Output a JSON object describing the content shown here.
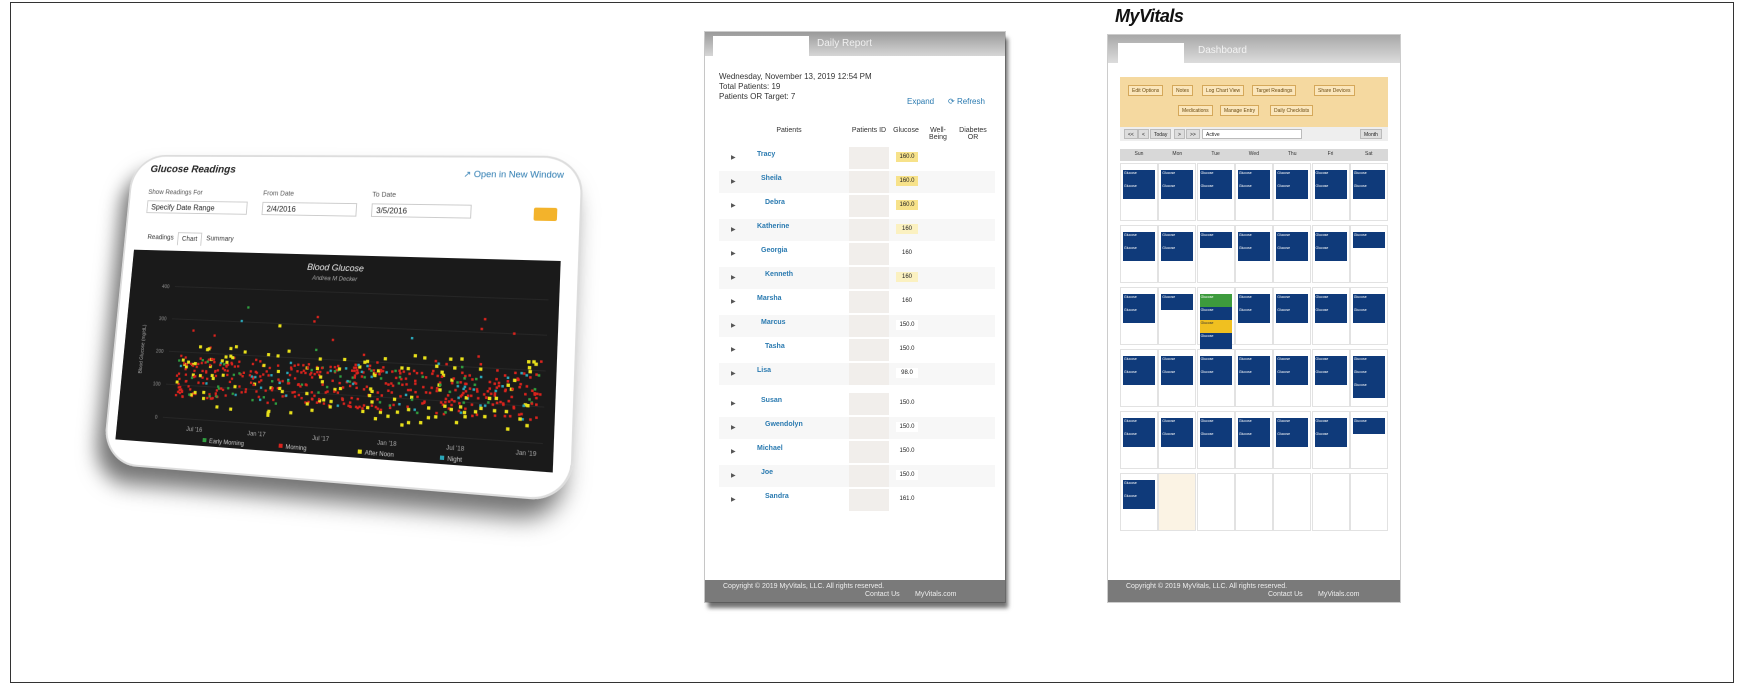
{
  "panel1": {
    "title": "Glucose Readings",
    "open_link": "Open in New Window",
    "show_label": "Show Readings For",
    "show_value": "Specify Date Range",
    "from_label": "From Date",
    "from_value": "2/4/2016",
    "to_label": "To Date",
    "to_value": "3/5/2016",
    "tabs": [
      "Readings",
      "Chart",
      "Summary"
    ],
    "chart_data": {
      "type": "scatter",
      "title": "Blood Glucose",
      "subtitle": "Andrea M Decker",
      "ylabel": "Blood Glucose (mg/dL)",
      "x_ticks": [
        "Jul '16",
        "Jan '17",
        "Jul '17",
        "Jan '18",
        "Jul '18",
        "Jan '19"
      ],
      "y_ticks": [
        "400",
        "300",
        "200",
        "100",
        "0"
      ],
      "series": [
        {
          "name": "Early Morning",
          "color": "#2f9d3f"
        },
        {
          "name": "Morning",
          "color": "#d9231d"
        },
        {
          "name": "After Noon",
          "color": "#e8e01a"
        },
        {
          "name": "Night",
          "color": "#2aa6b8"
        }
      ]
    }
  },
  "panel2": {
    "header_title": "Daily Report",
    "date_line": "Wednesday, November 13, 2019 12:54 PM",
    "total_line": "Total Patients: 19",
    "target_line": "Patients OR Target: 7",
    "expand": "Expand",
    "refresh": "Refresh",
    "columns": [
      "Patients",
      "Patients ID",
      "Glucose",
      "Well-Being",
      "Diabetes OR"
    ],
    "rows": [
      {
        "name": "Tracy",
        "value": "160.0",
        "color": "#f7e28a"
      },
      {
        "name": "Sheila",
        "value": "160.0",
        "color": "#f7e28a"
      },
      {
        "name": "Debra",
        "value": "160.0",
        "color": "#f7e28a"
      },
      {
        "name": "Katherine",
        "value": "160",
        "color": "#fbf1c1"
      },
      {
        "name": "Georgia",
        "value": "160",
        "color": "#ffffff"
      },
      {
        "name": "Kenneth",
        "value": "160",
        "color": "#fbf1c1"
      },
      {
        "name": "Marsha",
        "value": "160",
        "color": "#ffffff"
      },
      {
        "name": "Marcus",
        "value": "150.0",
        "color": "#ffffff"
      },
      {
        "name": "Tasha",
        "value": "150.0",
        "color": "#ffffff"
      },
      {
        "name": "Lisa",
        "value": "98.0",
        "color": "#ffffff"
      },
      {
        "name": "Susan",
        "value": "150.0",
        "color": "#ffffff"
      },
      {
        "name": "Gwendolyn",
        "value": "150.0",
        "color": "#ffffff"
      },
      {
        "name": "Michael",
        "value": "150.0",
        "color": "#ffffff"
      },
      {
        "name": "Joe",
        "value": "150.0",
        "color": "#ffffff"
      },
      {
        "name": "Sandra",
        "value": "161.0",
        "color": "#ffffff"
      }
    ],
    "footer_copyright": "Copyright © 2019 MyVitals, LLC. All rights reserved.",
    "footer_contact": "Contact Us",
    "footer_site": "MyVitals.com"
  },
  "panel3": {
    "logo": "MyVitals",
    "header_title": "Dashboard",
    "buttons_row1": [
      "Edit Options",
      "Notes",
      "Log Chart View",
      "Target Readings",
      "Share Devices"
    ],
    "buttons_row2": [
      "Medications",
      "Manage Entry",
      "Daily Checklists"
    ],
    "nav": [
      "<<",
      "<",
      "Today",
      ">",
      ">>",
      "Active",
      "Month"
    ],
    "days": [
      "Sun",
      "Mon",
      "Tue",
      "Wed",
      "Thu",
      "Fri",
      "Sat"
    ],
    "event_label": "Glucose",
    "footer_copyright": "Copyright © 2019 MyVitals, LLC. All rights reserved.",
    "footer_contact": "Contact Us",
    "footer_site": "MyVitals.com"
  }
}
